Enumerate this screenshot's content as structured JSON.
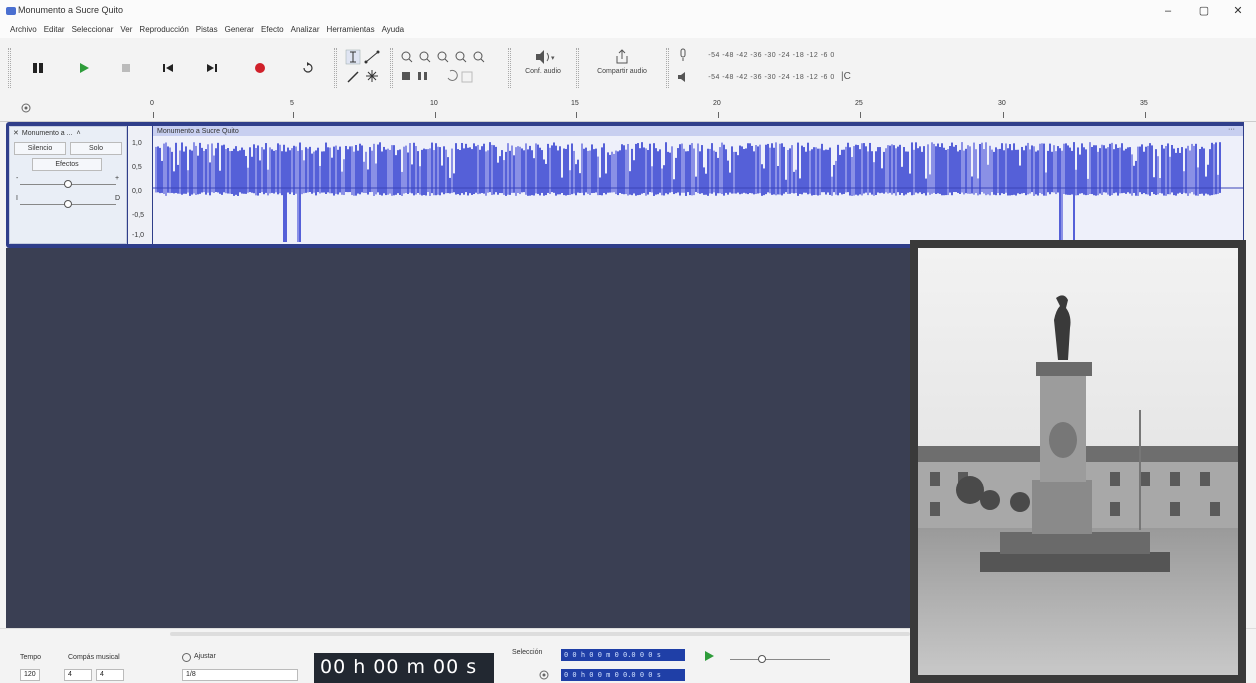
{
  "window": {
    "title": "Monumento a Sucre Quito",
    "minimize": "–",
    "maximize": "▢",
    "close": "✕"
  },
  "menu": [
    "Archivo",
    "Editar",
    "Seleccionar",
    "Ver",
    "Reproducción",
    "Pistas",
    "Generar",
    "Efecto",
    "Analizar",
    "Herramientas",
    "Ayuda"
  ],
  "toolbar": {
    "audio_setup_label": "Conf. audio",
    "share_audio_label": "Compartir audio",
    "meter_scale": "-54 -48 -42 -36 -30 -24 -18 -12 -6 0"
  },
  "ruler": {
    "ticks": [
      "0",
      "5",
      "10",
      "15",
      "20",
      "25",
      "30",
      "35"
    ]
  },
  "track": {
    "name": "Monumento a ...",
    "clip_name": "Monumento a Sucre Quito",
    "mute_label": "Silencio",
    "solo_label": "Solo",
    "effects_label": "Efectos",
    "gain_minus": "-",
    "gain_plus": "+",
    "pan_left": "I",
    "pan_right": "D",
    "scale": [
      "1,0",
      "0,5",
      "0,0",
      "-0,5",
      "-1,0"
    ]
  },
  "bottom": {
    "tempo_label": "Tempo",
    "tempo_value": "120",
    "timesig_label": "Compás musical",
    "timesig_num": "4",
    "timesig_den": "4",
    "snap_label": "Ajustar",
    "snap_value": "1/8",
    "time_display": "00 h 00 m 00 s",
    "selection_label": "Selección",
    "sel_start": "0 0 h 0 0 m 0 0.0 0 0 s",
    "sel_end": "0 0 h 0 0 m 0 0.0 0 0 s"
  },
  "colors": {
    "waveform": "#5560d8",
    "waveform_bg": "#eef0fa",
    "track_border": "#2f3e8a",
    "empty_area": "#3a3f53",
    "record": "#d0202a",
    "play": "#2e9c3a"
  }
}
